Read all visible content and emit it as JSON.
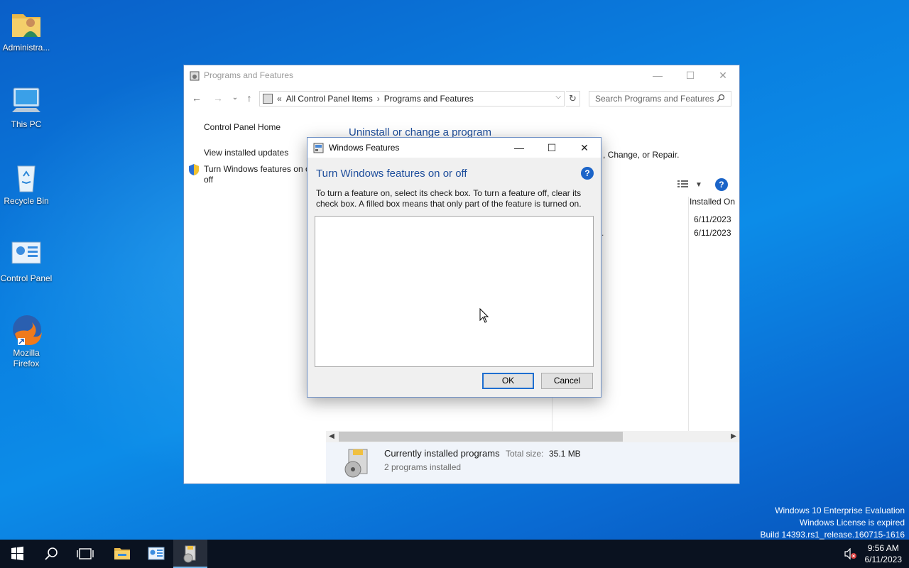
{
  "desktop": {
    "icons": [
      {
        "label": "Administra...",
        "icon": "user-folder-icon"
      },
      {
        "label": "This PC",
        "icon": "computer-icon"
      },
      {
        "label": "Recycle Bin",
        "icon": "recycle-bin-icon"
      },
      {
        "label": "Control Panel",
        "icon": "control-panel-icon"
      },
      {
        "label": "Mozilla Firefox",
        "icon": "firefox-icon"
      }
    ],
    "watermark": {
      "line1": "Windows 10 Enterprise Evaluation",
      "line2": "Windows License is expired",
      "line3": "Build 14393.rs1_release.160715-1616"
    }
  },
  "programs_window": {
    "title": "Programs and Features",
    "address": {
      "prefix": "«",
      "crumb1": "All Control Panel Items",
      "sep": "›",
      "crumb2": "Programs and Features"
    },
    "search_placeholder": "Search Programs and Features",
    "left_links": {
      "home": "Control Panel Home",
      "updates": "View installed updates",
      "features_line1": "Turn Windows features on or",
      "features_line2": "off"
    },
    "heading": "Uninstall or change a program",
    "subtext": ", Change, or Repair.",
    "column_header": "Installed On",
    "dates": [
      "6/11/2023",
      "6/11/2023"
    ],
    "partial_cell": ".",
    "details": {
      "title": "Currently installed programs",
      "size_label": "Total size:",
      "size_value": "35.1 MB",
      "count": "2 programs installed"
    }
  },
  "features_dialog": {
    "title": "Windows Features",
    "heading": "Turn Windows features on or off",
    "description": "To turn a feature on, select its check box. To turn a feature off, clear its check box. A filled box means that only part of the feature is turned on.",
    "ok_label": "OK",
    "cancel_label": "Cancel",
    "help_glyph": "?"
  },
  "taskbar": {
    "time": "9:56 AM",
    "date": "6/11/2023"
  },
  "colors": {
    "accent_blue": "#1e4e9c",
    "help_blue": "#1b64c8",
    "taskbar": "#0a1220"
  }
}
